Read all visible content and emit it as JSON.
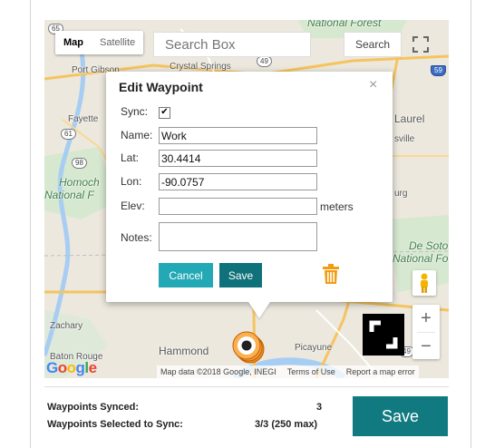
{
  "map": {
    "type_controls": {
      "map": "Map",
      "satellite": "Satellite"
    },
    "search": {
      "placeholder": "Search Box",
      "button": "Search"
    },
    "labels": {
      "national_forest_top": "National Forest",
      "port_gibson": "Port Gibson",
      "crystal_springs": "Crystal Springs",
      "fayette": "Fayette",
      "homochitto_1": "Homoch",
      "homochitto_2": "National F",
      "laurel": "Laurel",
      "ellisville": "sville",
      "hattiesburg": "urg",
      "de_soto_1": "De Soto",
      "de_soto_2": "National Fo",
      "zachary": "Zachary",
      "hammond": "Hammond",
      "picayune": "Picayune",
      "baton_rouge": "Baton Rouge"
    },
    "shields": {
      "us61": "61",
      "us98": "98",
      "i59": "59",
      "us49": "49",
      "i49b": "49",
      "s65": "65"
    },
    "zoom": {
      "in": "+",
      "out": "−"
    },
    "google_logo": "Google",
    "attribution": {
      "data": "Map data ©2018 Google, INEGI",
      "terms": "Terms of Use",
      "report": "Report a map error"
    },
    "colors": {
      "road": "#f5c45e",
      "water": "#a7cdf2",
      "land": "#ece8de",
      "forest": "#cde6c6"
    }
  },
  "dialog": {
    "title": "Edit Waypoint",
    "close": "×",
    "fields": {
      "sync_label": "Sync:",
      "sync_checked": "✔",
      "name_label": "Name:",
      "name_value": "Work",
      "lat_label": "Lat:",
      "lat_value": "30.4414",
      "lon_label": "Lon:",
      "lon_value": "-90.0757",
      "elev_label": "Elev:",
      "elev_value": "",
      "elev_units": "meters",
      "notes_label": "Notes:",
      "notes_value": ""
    },
    "buttons": {
      "cancel": "Cancel",
      "save": "Save"
    },
    "colors": {
      "cancel": "#22a9b5",
      "save": "#0f7179",
      "trash": "#f39c12"
    }
  },
  "footer": {
    "synced_label": "Waypoints Synced:",
    "synced_value": "3",
    "selected_label": "Waypoints Selected to Sync:",
    "selected_value": "3/3 (250 max)",
    "save_button": "Save",
    "save_color": "#117a80"
  }
}
